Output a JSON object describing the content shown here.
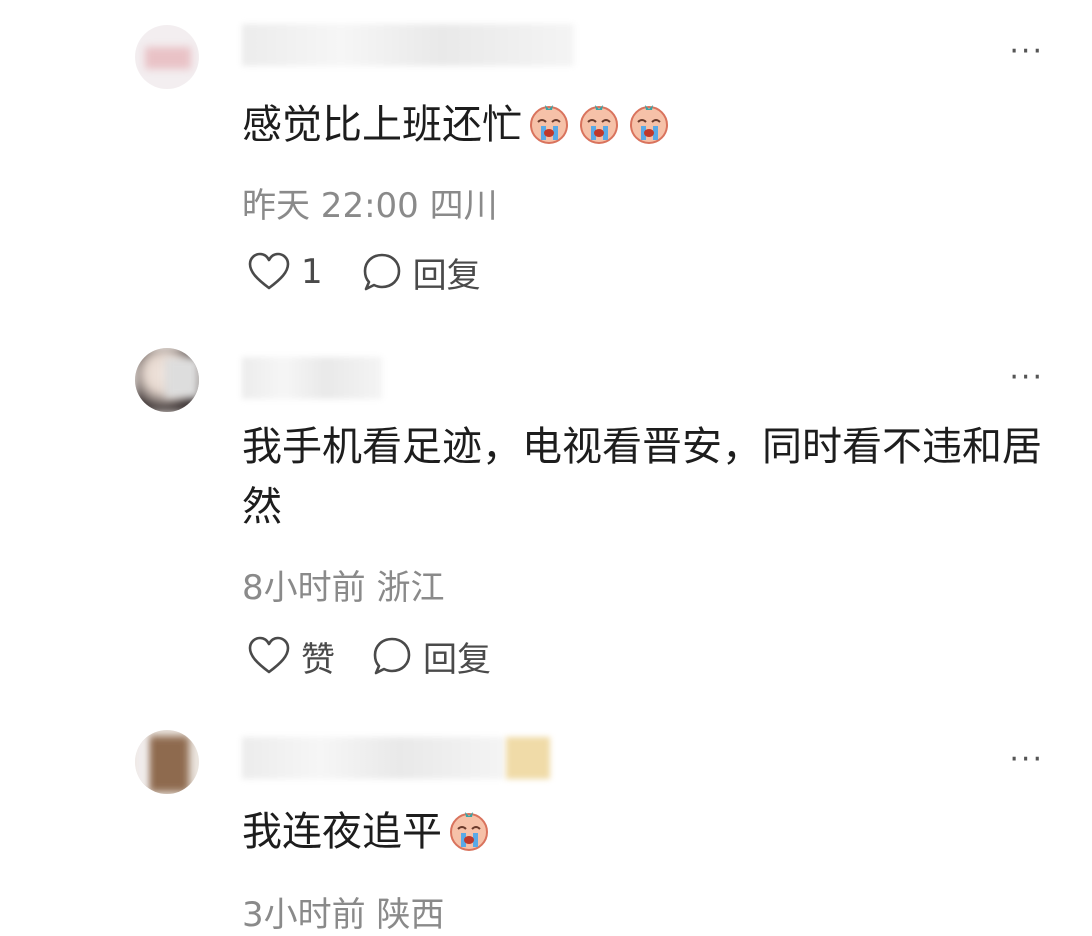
{
  "comments": [
    {
      "text": "感觉比上班还忙",
      "emoji_count": 3,
      "meta": "昨天 22:00 四川",
      "like_label": "1",
      "reply_label": "回复",
      "more_label": "···"
    },
    {
      "text": "我手机看足迹，电视看晋安，同时看不违和居然",
      "emoji_count": 0,
      "meta": "8小时前 浙江",
      "like_label": "赞",
      "reply_label": "回复",
      "more_label": "···"
    },
    {
      "text": "我连夜追平",
      "emoji_count": 1,
      "meta": "3小时前 陕西",
      "more_label": "···"
    }
  ],
  "emoji_icon": "crying-face-emoji",
  "colors": {
    "text": "#1d1d1d",
    "meta": "#8a8a8a",
    "icon": "#4a4a4a"
  }
}
